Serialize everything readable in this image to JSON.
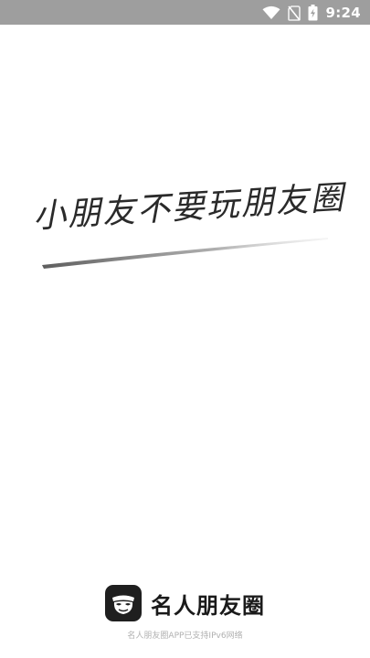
{
  "status_bar": {
    "time": "9:24",
    "background": "#9e9e9e",
    "icons": [
      "wifi-icon",
      "no-sim-icon",
      "battery-charging-icon"
    ]
  },
  "splash": {
    "slogan": "小朋友不要玩朋友圈"
  },
  "brand": {
    "logo_icon": "mask-face-logo-icon",
    "name": "名人朋友圈"
  },
  "footer": {
    "note": "名人朋友圈APP已支持IPv6网络"
  }
}
